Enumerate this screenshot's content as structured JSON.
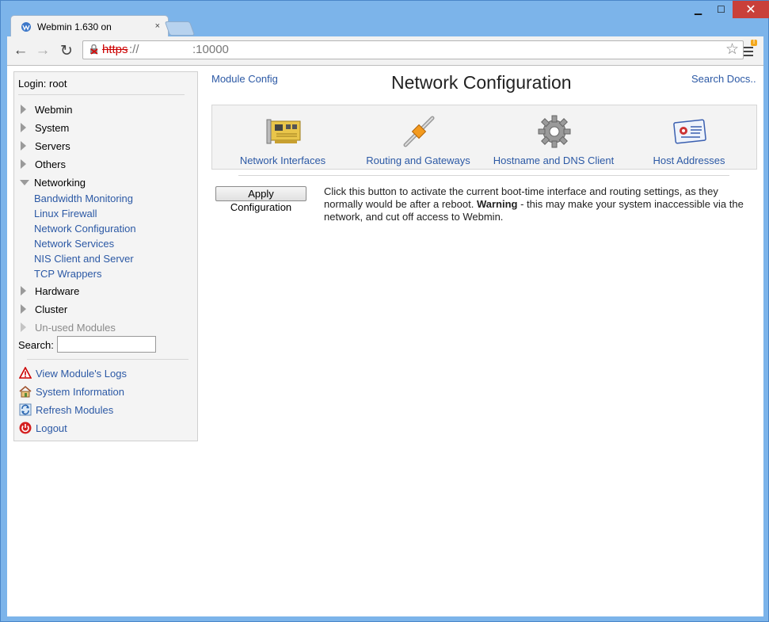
{
  "browser": {
    "tab_title": "Webmin 1.630 on",
    "tab_close": "×",
    "window_controls": {
      "minimize": "▁",
      "maximize": "☐",
      "close": "✕"
    },
    "address": {
      "scheme": "https",
      "rest": "://",
      "port": ":10000"
    },
    "nav": {
      "back": "←",
      "forward": "→",
      "reload": "↻"
    },
    "star": "☆",
    "menu_badge": "!"
  },
  "sidebar": {
    "login": "Login: root",
    "categories": [
      {
        "label": "Webmin",
        "open": false
      },
      {
        "label": "System",
        "open": false
      },
      {
        "label": "Servers",
        "open": false
      },
      {
        "label": "Others",
        "open": false
      },
      {
        "label": "Networking",
        "open": true
      },
      {
        "label": "Hardware",
        "open": false
      },
      {
        "label": "Cluster",
        "open": false
      },
      {
        "label": "Un-used Modules",
        "open": false
      }
    ],
    "networking_modules": [
      "Bandwidth Monitoring",
      "Linux Firewall",
      "Network Configuration",
      "Network Services",
      "NIS Client and Server",
      "TCP Wrappers"
    ],
    "search_label": "Search:",
    "search_value": "",
    "actions": [
      {
        "label": "View Module's Logs",
        "icon": "warning-icon"
      },
      {
        "label": "System Information",
        "icon": "house-icon"
      },
      {
        "label": "Refresh Modules",
        "icon": "refresh-icon"
      },
      {
        "label": "Logout",
        "icon": "power-icon"
      }
    ]
  },
  "main": {
    "module_config": "Module Config",
    "title": "Network Configuration",
    "search_docs": "Search Docs..",
    "icons": [
      {
        "label": "Network Interfaces",
        "icon": "network-card-icon"
      },
      {
        "label": "Routing and Gateways",
        "icon": "routing-icon"
      },
      {
        "label": "Hostname and DNS Client",
        "icon": "gear-icon"
      },
      {
        "label": "Host Addresses",
        "icon": "address-card-icon"
      }
    ],
    "apply_button": "Apply Configuration",
    "description_pre": "Click this button to activate the current boot-time interface and routing settings, as they normally would be after a reboot. ",
    "description_bold": "Warning",
    "description_post": " - this may make your system inaccessible via the network, and cut off access to Webmin."
  }
}
